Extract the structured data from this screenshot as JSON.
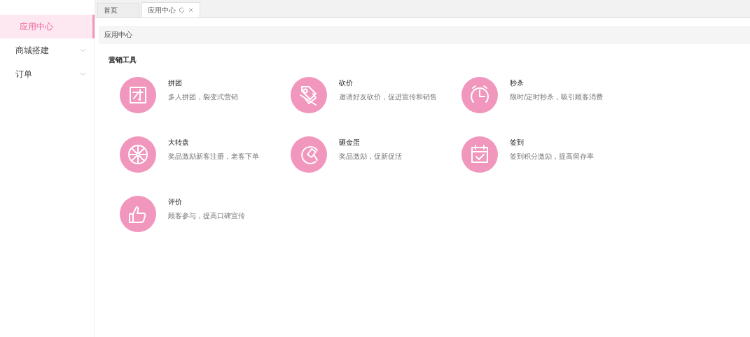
{
  "sidebar": {
    "items": [
      {
        "label": "应用中心",
        "selected": true,
        "expandable": false
      },
      {
        "label": "商城搭建",
        "selected": false,
        "expandable": true
      },
      {
        "label": "订单",
        "selected": false,
        "expandable": true
      }
    ]
  },
  "tabs": [
    {
      "label": "首页",
      "selected": false,
      "closable": false
    },
    {
      "label": "应用中心",
      "selected": true,
      "closable": true
    }
  ],
  "breadcrumb": "应用中心",
  "section_title": "营销工具",
  "tools": [
    {
      "name": "拼团",
      "desc": "多人拼团，裂变式营销"
    },
    {
      "name": "砍价",
      "desc": "邀请好友砍价，促进宣传和销售"
    },
    {
      "name": "秒杀",
      "desc": "限时/定时秒杀，吸引顾客消费"
    },
    {
      "name": "大转盘",
      "desc": "奖品激励新客注册，老客下单"
    },
    {
      "name": "砸金蛋",
      "desc": "奖品激励，促新促活"
    },
    {
      "name": "签到",
      "desc": "签到积分激励，提高留存率"
    },
    {
      "name": "评价",
      "desc": "顾客参与，提高口碑宣传"
    }
  ]
}
